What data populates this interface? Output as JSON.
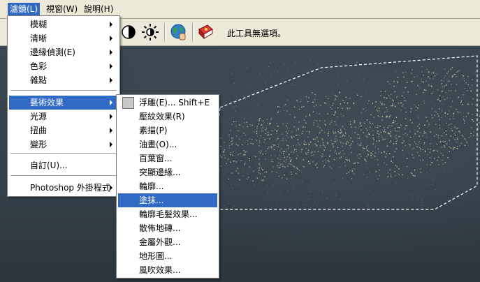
{
  "menubar": {
    "items": [
      {
        "label": "濾鏡(L)"
      },
      {
        "label": "視窗(W)"
      },
      {
        "label": "說明(H)"
      }
    ]
  },
  "options": {
    "message": "此工具無選項。",
    "icons": [
      "contrast-half-icon",
      "brightness-icon",
      "globe-hand-icon",
      "red-book-icon"
    ]
  },
  "filter_menu": {
    "items": [
      {
        "label": "模糊",
        "has_submenu": true
      },
      {
        "label": "清晰",
        "has_submenu": true
      },
      {
        "label": "邊緣偵測(E)",
        "has_submenu": true
      },
      {
        "label": "色彩",
        "has_submenu": true
      },
      {
        "label": "雜點",
        "has_submenu": true
      },
      {
        "label": "藝術效果",
        "has_submenu": true,
        "highlighted": true
      },
      {
        "label": "光源",
        "has_submenu": true
      },
      {
        "label": "扭曲",
        "has_submenu": true
      },
      {
        "label": "變形",
        "has_submenu": true
      },
      {
        "label": "自訂(U)..."
      },
      {
        "label": "Photoshop 外掛程式",
        "has_submenu": true
      }
    ]
  },
  "artistic_submenu": {
    "items": [
      {
        "label": "浮雕(E)... Shift+E",
        "checked": true
      },
      {
        "label": "壓紋效果(R)"
      },
      {
        "label": "素描(P)"
      },
      {
        "label": "油畫(O)..."
      },
      {
        "label": "百葉窗..."
      },
      {
        "label": "突顯邊緣..."
      },
      {
        "label": "輪廓..."
      },
      {
        "label": "塗抹...",
        "highlighted": true
      },
      {
        "label": "輪廓毛髮效果..."
      },
      {
        "label": "散佈地磚..."
      },
      {
        "label": "金屬外觀..."
      },
      {
        "label": "地形圖..."
      },
      {
        "label": "風吹效果..."
      }
    ]
  },
  "colors": {
    "menu_highlight": "#316ac5",
    "menubar_bg": "#ece9d8",
    "canvas_bg": "#36424b"
  }
}
